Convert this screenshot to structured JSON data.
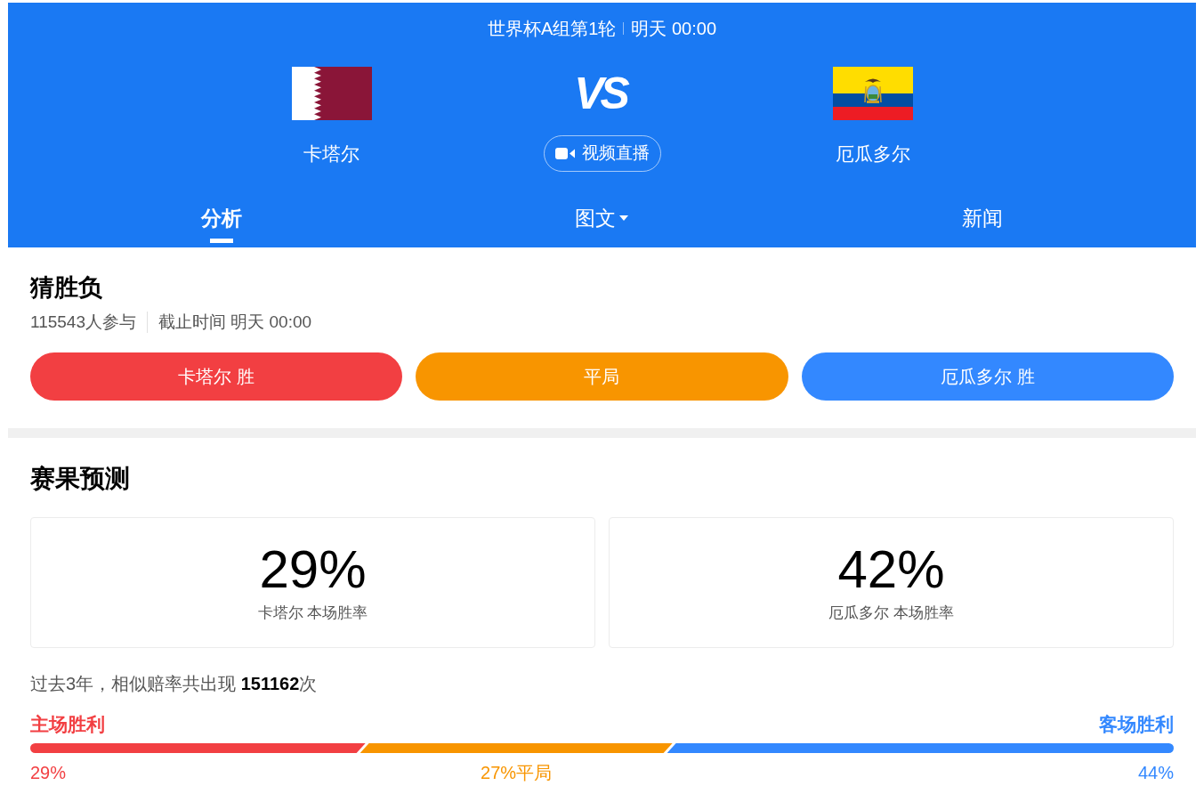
{
  "header": {
    "match_info": "世界杯A组第1轮",
    "kickoff": "明天 00:00",
    "home_team": {
      "name": "卡塔尔"
    },
    "vs_label": "VS",
    "live_button": "视频直播",
    "away_team": {
      "name": "厄瓜多尔"
    },
    "tabs": [
      {
        "label": "分析",
        "selected": true,
        "kind": "plain"
      },
      {
        "label": "图文",
        "selected": false,
        "kind": "dropdown"
      },
      {
        "label": "新闻",
        "selected": false,
        "kind": "plain"
      }
    ]
  },
  "guess": {
    "title": "猜胜负",
    "participants": "115543人参与",
    "deadline": "截止时间 明天 00:00",
    "options": [
      {
        "label": "卡塔尔 胜",
        "color": "#f23f42"
      },
      {
        "label": "平局",
        "color": "#f89500"
      },
      {
        "label": "厄瓜多尔 胜",
        "color": "#3388ff"
      }
    ]
  },
  "prediction": {
    "title": "赛果预测",
    "cards": [
      {
        "percent": "29%",
        "label": "卡塔尔 本场胜率"
      },
      {
        "percent": "42%",
        "label": "厄瓜多尔 本场胜率"
      }
    ],
    "history": "过去3年，相似赔率共出现 **151162**次",
    "home_label": "主场胜利",
    "away_label": "客场胜利",
    "bar": [
      {
        "kind": "home",
        "level": 0.29,
        "reading": "29%",
        "color": "#f23f42"
      },
      {
        "kind": "draw",
        "reading": "27%平局",
        "color": "#f89500"
      },
      {
        "kind": "away",
        "level": 0.44,
        "reading": "44%",
        "color": "#3388ff"
      }
    ]
  }
}
